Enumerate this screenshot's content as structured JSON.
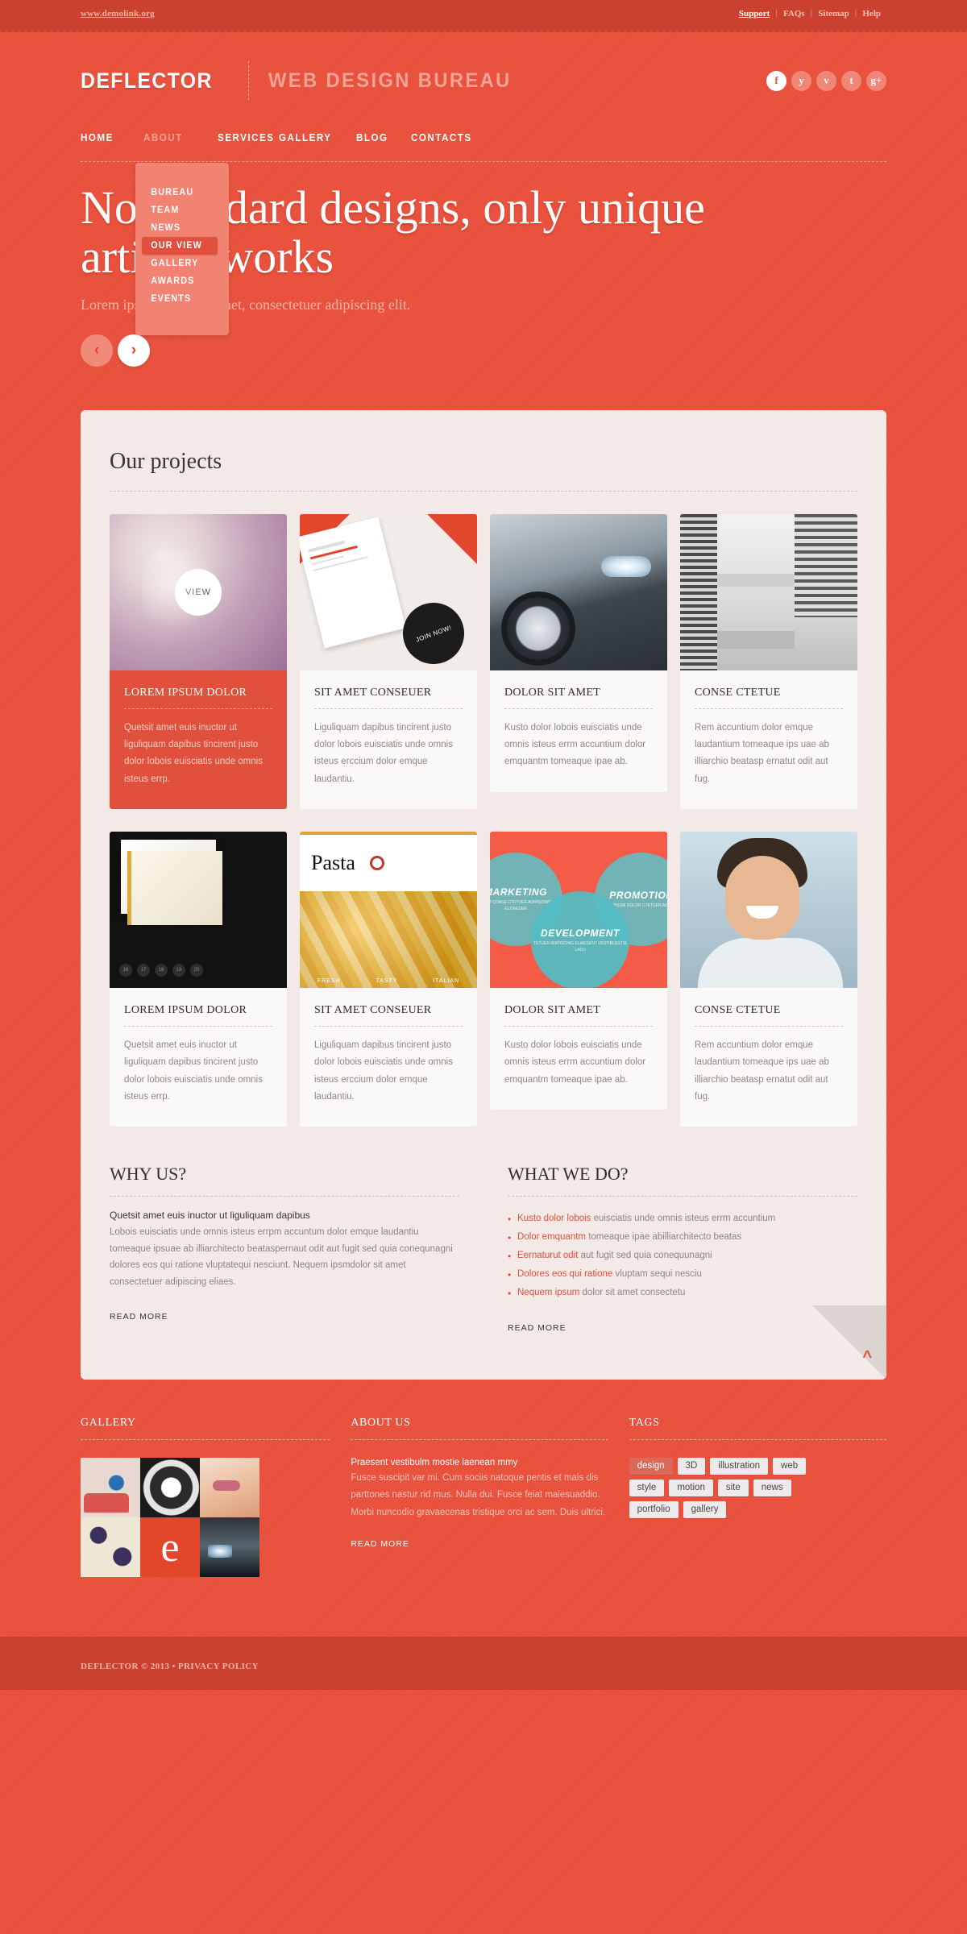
{
  "topbar": {
    "demo_link": "www.demolink.org",
    "links": [
      {
        "label": "Support",
        "strong": true
      },
      {
        "label": "FAQs",
        "strong": false
      },
      {
        "label": "Sitemap",
        "strong": false
      },
      {
        "label": "Help",
        "strong": false
      }
    ],
    "separator": "|"
  },
  "header": {
    "brand_name": "DEFLECTOR",
    "brand_tagline": "WEB DESIGN BUREAU",
    "socials": [
      {
        "name": "facebook-icon",
        "glyph": "f",
        "active": true
      },
      {
        "name": "twitter-icon",
        "glyph": "y",
        "active": false
      },
      {
        "name": "vimeo-icon",
        "glyph": "v",
        "active": false
      },
      {
        "name": "tumblr-icon",
        "glyph": "t",
        "active": false
      },
      {
        "name": "google-plus-icon",
        "glyph": "g+",
        "active": false
      }
    ]
  },
  "nav": {
    "items": [
      {
        "label": "HOME",
        "dim": false
      },
      {
        "label": "ABOUT",
        "dim": true
      },
      {
        "label": "SERVICES",
        "dim": false
      },
      {
        "label": "GALLERY",
        "dim": false
      },
      {
        "label": "BLOG",
        "dim": false
      },
      {
        "label": "CONTACTS",
        "dim": false
      }
    ],
    "dropdown": [
      {
        "label": "BUREAU",
        "active": false
      },
      {
        "label": "TEAM",
        "active": false
      },
      {
        "label": "NEWS",
        "active": false
      },
      {
        "label": "OUR VIEW",
        "active": true
      },
      {
        "label": "GALLERY",
        "active": false
      },
      {
        "label": "AWARDS",
        "active": false
      },
      {
        "label": "EVENTS",
        "active": false
      }
    ]
  },
  "hero": {
    "title": "No standard designs, only unique artistic works",
    "subtitle": "Lorem ipsum dolor sit amet, consectetuer adipiscing elit.",
    "prev_label": "‹",
    "next_label": "›"
  },
  "projects": {
    "section_title": "Our projects",
    "view_label": "VIEW",
    "row1": [
      {
        "title": "LOREM IPSUM DOLOR",
        "text": "Quetsit amet euis inuctor ut liguliquam dapibus tincirent justo dolor lobois euisciatis unde omnis isteus errp.",
        "thumb": "woman-profile-photo",
        "highlighted": true,
        "has_view": true
      },
      {
        "title": "SIT AMET CONSEUER",
        "text": "Liguliquam dapibus tincirent justo dolor lobois euisciatis unde omnis isteus erccium dolor emque laudantiu.",
        "thumb": "leaflet-design-photo",
        "highlighted": false,
        "has_view": false
      },
      {
        "title": "DOLOR SIT AMET",
        "text": "Kusto dolor lobois euisciatis unde omnis isteus errm accuntium dolor emquantm tomeaque ipae ab.",
        "thumb": "car-headlight-photo",
        "highlighted": false,
        "has_view": false
      },
      {
        "title": "CONSE CTETUE",
        "text": "Rem accuntium dolor emque laudantium tomeaque ips uae ab illiarchio beatasp ernatut odit aut fug.",
        "thumb": "architecture-photo",
        "highlighted": false,
        "has_view": false
      }
    ],
    "row2": [
      {
        "title": "LOREM IPSUM DOLOR",
        "text": "Quetsit amet euis inuctor ut liguliquam dapibus tincirent justo dolor lobois euisciatis unde omnis isteus errp.",
        "thumb": "book-page-photo",
        "highlighted": false,
        "has_view": false
      },
      {
        "title": "SIT AMET CONSEUER",
        "text": "Liguliquam dapibus tincirent justo dolor lobois euisciatis unde omnis isteus erccium dolor emque laudantiu.",
        "thumb": "pasta-package-photo",
        "highlighted": false,
        "has_view": false
      },
      {
        "title": "DOLOR SIT AMET",
        "text": "Kusto dolor lobois euisciatis unde omnis isteus errm accuntium dolor emquantm tomeaque ipae ab.",
        "thumb": "venn-diagram-photo",
        "highlighted": false,
        "has_view": false
      },
      {
        "title": "CONSE CTETUE",
        "text": "Rem accuntium dolor emque laudantium tomeaque ips uae ab illiarchio beatasp ernatut odit aut fug.",
        "thumb": "smiling-man-photo",
        "highlighted": false,
        "has_view": false
      }
    ],
    "thumb_art": {
      "leaflet_badge": "JOIN NOW!",
      "book_dots": [
        "16",
        "17",
        "18",
        "19",
        "20"
      ],
      "pasta_word": "Pasta",
      "pasta_caption": [
        "FRESH",
        "TASTY",
        "ITALIAN"
      ],
      "venn": [
        {
          "label": "MARKETING",
          "sub": "AMET CONSE CTETUER ADIPISCING ELITAESEN"
        },
        {
          "label": "PROMOTION",
          "sub": "LOREM IPSUM DOLOR CTETUER ADIPISCING"
        },
        {
          "label": "DEVELOPMENT",
          "sub": "TETUER ADIPISCING ELIAESENT VESTIBUESTIE LACU"
        }
      ]
    }
  },
  "why_us": {
    "title": "WHY US?",
    "lead": "Quetsit amet euis inuctor ut liguliquam dapibus",
    "body": "Lobois euisciatis unde omnis isteus errpm accuntum dolor emque laudantiu tomeaque ipsuae ab illiarchitecto beataspernaut odit aut fugit sed quia conequnagni dolores eos qui ratione vluptatequi nesciunt. Nequem ipsmdolor sit amet consectetuer adipiscing eliaes.",
    "read_more": "READ MORE"
  },
  "what_we_do": {
    "title": "WHAT WE DO?",
    "items": [
      {
        "strong": "Kusto dolor lobois",
        "rest": " euisciatis unde omnis isteus errm accuntium"
      },
      {
        "strong": "Dolor emquantm",
        "rest": " tomeaque ipae abilliarchitecto beatas"
      },
      {
        "strong": "Eernaturut odit",
        "rest": " aut fugit sed quia conequunagni"
      },
      {
        "strong": "Dolores eos qui ratione",
        "rest": " vluptam sequi nesciu"
      },
      {
        "strong": "Nequem ipsum",
        "rest": " dolor sit amet consectetu"
      }
    ],
    "read_more": "READ MORE"
  },
  "scroll_top": {
    "label": "^",
    "name": "scroll-to-top"
  },
  "footer": {
    "gallery": {
      "title": "GALLERY",
      "thumbs": [
        "eye-photo",
        "wheel-photo",
        "lips-photo",
        "fabric-photo",
        "letter-e-photo",
        "car-light-photo"
      ]
    },
    "about": {
      "title": "ABOUT US",
      "lead": "Praesent vestibulm mostie laenean mmy",
      "body": "Fusce suscipit var mi. Cum sociis natoque pentis et mais dis parttones nastur rid mus. Nulla dui. Fusce feiat malesuaddio. Morbi nuncodio gravaecenas tristique orci ac sem. Duis ultrici.",
      "read_more": "READ MORE"
    },
    "tags": {
      "title": "TAGS",
      "items": [
        {
          "label": "design",
          "active": true
        },
        {
          "label": "3D",
          "active": false
        },
        {
          "label": "illustration",
          "active": false
        },
        {
          "label": "web",
          "active": false
        },
        {
          "label": "style",
          "active": false
        },
        {
          "label": "motion",
          "active": false
        },
        {
          "label": "site",
          "active": false
        },
        {
          "label": "news",
          "active": false
        },
        {
          "label": "portfolio",
          "active": false
        },
        {
          "label": "gallery",
          "active": false
        }
      ]
    }
  },
  "copyright": {
    "text": "DEFLECTOR © 2013 • PRIVACY POLICY"
  },
  "colors": {
    "brand_red": "#e8503c",
    "dark_red": "#ca4130",
    "panel_bg": "#f3e9e6",
    "card_bg": "#fbf9f8",
    "accent_light": "#f28271"
  }
}
